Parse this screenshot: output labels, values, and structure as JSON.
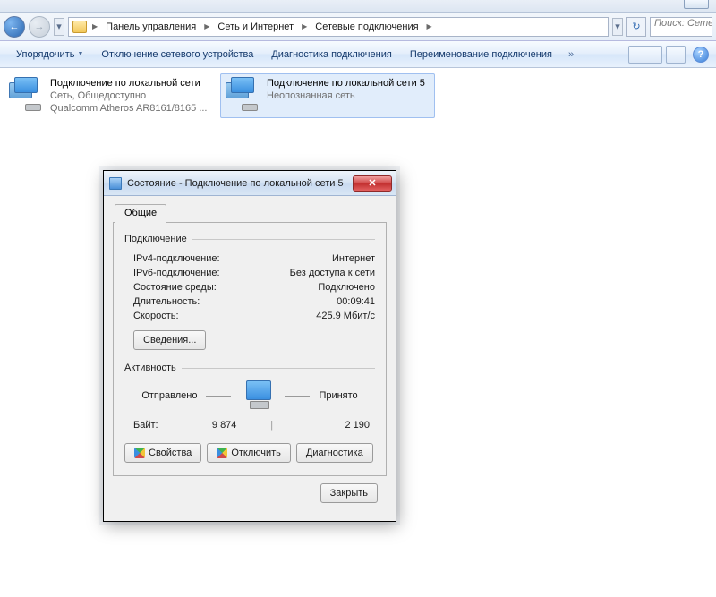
{
  "breadcrumb": {
    "item1": "Панель управления",
    "item2": "Сеть и Интернет",
    "item3": "Сетевые подключения"
  },
  "search": {
    "placeholder": "Поиск: Сетев"
  },
  "toolbar": {
    "organize": "Упорядочить",
    "disable": "Отключение сетевого устройства",
    "diagnose": "Диагностика подключения",
    "rename": "Переименование подключения"
  },
  "connections": [
    {
      "name": "Подключение по локальной сети",
      "status": "Сеть, Общедоступно",
      "device": "Qualcomm Atheros AR8161/8165 ..."
    },
    {
      "name": "Подключение по локальной сети 5",
      "status": "Неопознанная сеть",
      "device": ""
    }
  ],
  "dialog": {
    "title": "Состояние - Подключение по локальной сети 5",
    "tab": "Общие",
    "group_connection": "Подключение",
    "rows": {
      "ipv4_k": "IPv4-подключение:",
      "ipv4_v": "Интернет",
      "ipv6_k": "IPv6-подключение:",
      "ipv6_v": "Без доступа к сети",
      "media_k": "Состояние среды:",
      "media_v": "Подключено",
      "dur_k": "Длительность:",
      "dur_v": "00:09:41",
      "speed_k": "Скорость:",
      "speed_v": "425.9 Мбит/с"
    },
    "details_btn": "Сведения...",
    "group_activity": "Активность",
    "sent_label": "Отправлено",
    "recv_label": "Принято",
    "bytes_label": "Байт:",
    "bytes_sent": "9 874",
    "bytes_recv": "2 190",
    "properties_btn": "Свойства",
    "disable_btn": "Отключить",
    "diagnose_btn": "Диагностика",
    "close_btn": "Закрыть"
  }
}
